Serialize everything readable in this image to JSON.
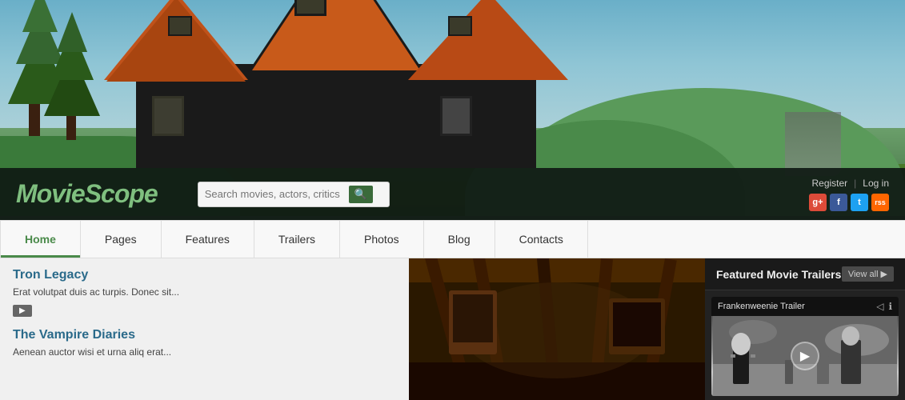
{
  "site": {
    "name_part1": "Movie",
    "name_part2": "Scope"
  },
  "header": {
    "search_placeholder": "Search movies, actors, critics",
    "register_label": "Register",
    "login_label": "Log in",
    "separator": "|"
  },
  "social": {
    "gplus": "g+",
    "facebook": "f",
    "twitter": "t",
    "rss": "rss"
  },
  "nav": {
    "items": [
      {
        "label": "Home",
        "active": true
      },
      {
        "label": "Pages",
        "active": false
      },
      {
        "label": "Features",
        "active": false
      },
      {
        "label": "Trailers",
        "active": false
      },
      {
        "label": "Photos",
        "active": false
      },
      {
        "label": "Blog",
        "active": false
      },
      {
        "label": "Contacts",
        "active": false
      }
    ]
  },
  "articles": [
    {
      "title": "Tron Legacy",
      "text": "Erat volutpat duis ac turpis. Donec sit...",
      "read_more": "▶"
    },
    {
      "title": "The Vampire Diaries",
      "text": "Aenean auctor wisi et urna aliq erat...",
      "read_more": "▶"
    }
  ],
  "sidebar": {
    "title": "Featured Movie Trailers",
    "view_all": "View all",
    "view_all_arrow": "▶",
    "trailer": {
      "name": "Frankenweenie Trailer",
      "share_icon": "◁",
      "info_icon": "ℹ",
      "play_icon": "▶"
    }
  }
}
